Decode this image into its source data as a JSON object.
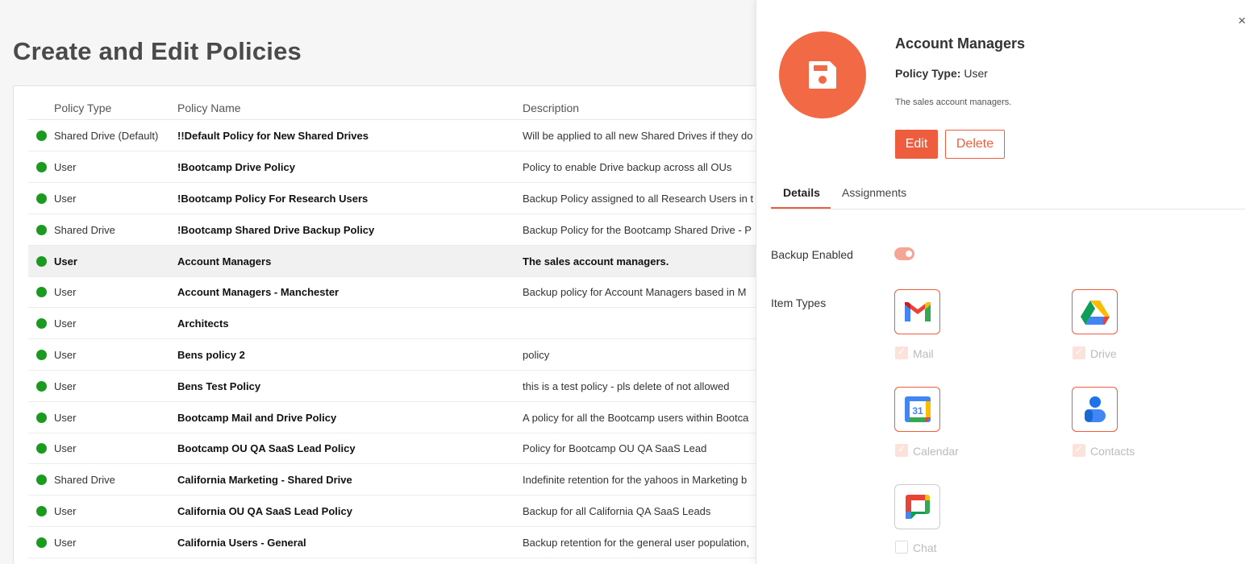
{
  "page": {
    "title": "Create and Edit Policies"
  },
  "table": {
    "headers": {
      "type": "Policy Type",
      "name": "Policy Name",
      "description": "Description"
    },
    "rows": [
      {
        "type": "Shared Drive (Default)",
        "name": "!!Default Policy for New Shared Drives",
        "description": "Will be applied to all new Shared Drives if they do"
      },
      {
        "type": "User",
        "name": "!Bootcamp Drive Policy",
        "description": "Policy to enable Drive backup across all OUs"
      },
      {
        "type": "User",
        "name": "!Bootcamp Policy For Research Users",
        "description": "Backup Policy assigned to all Research Users in t"
      },
      {
        "type": "Shared Drive",
        "name": "!Bootcamp Shared Drive Backup Policy",
        "description": "Backup Policy for the Bootcamp Shared Drive - P"
      },
      {
        "type": "User",
        "name": "Account Managers",
        "description": "The sales account managers."
      },
      {
        "type": "User",
        "name": "Account Managers - Manchester",
        "description": "Backup policy for Account Managers based in M"
      },
      {
        "type": "User",
        "name": "Architects",
        "description": ""
      },
      {
        "type": "User",
        "name": "Bens policy 2",
        "description": "policy"
      },
      {
        "type": "User",
        "name": "Bens Test Policy",
        "description": "this is a test policy - pls delete of not allowed"
      },
      {
        "type": "User",
        "name": "Bootcamp Mail and Drive Policy",
        "description": "A policy for all the Bootcamp users within Bootca"
      },
      {
        "type": "User",
        "name": "Bootcamp OU QA SaaS Lead Policy",
        "description": "Policy for Bootcamp OU QA SaaS Lead"
      },
      {
        "type": "Shared Drive",
        "name": "California Marketing - Shared Drive",
        "description": "Indefinite retention for the yahoos in Marketing b"
      },
      {
        "type": "User",
        "name": "California OU QA SaaS Lead Policy",
        "description": "Backup for all California QA SaaS Leads"
      },
      {
        "type": "User",
        "name": "California Users - General",
        "description": "Backup retention for the general user population,"
      }
    ]
  },
  "panel": {
    "close_label": "×",
    "title": "Account Managers",
    "policy_type_label": "Policy Type:",
    "policy_type_value": "User",
    "description": "The sales account managers.",
    "edit_label": "Edit",
    "delete_label": "Delete",
    "tabs": [
      {
        "label": "Details"
      },
      {
        "label": "Assignments"
      }
    ],
    "backup_enabled_label": "Backup Enabled",
    "backup_enabled": true,
    "item_types_label": "Item Types",
    "items": [
      {
        "label": "Mail",
        "icon": "gmail-icon",
        "checked": true
      },
      {
        "label": "Drive",
        "icon": "google-drive-icon",
        "checked": true
      },
      {
        "label": "Calendar",
        "icon": "google-calendar-icon",
        "checked": true,
        "calendar_day": "31"
      },
      {
        "label": "Contacts",
        "icon": "google-contacts-icon",
        "checked": true
      },
      {
        "label": "Chat",
        "icon": "google-chat-icon",
        "checked": false
      }
    ]
  },
  "colors": {
    "accent": "#ee5d3d",
    "active_dot": "#1a9b1f"
  }
}
